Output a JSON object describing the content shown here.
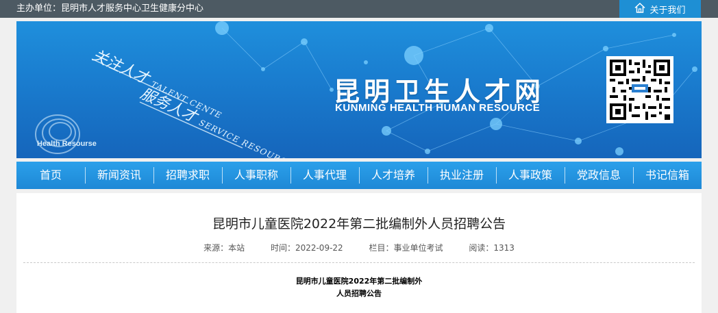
{
  "topbar": {
    "host": "主办单位：昆明市人才服务中心卫生健康分中心",
    "about_label": "关于我们",
    "about_icon": "home-icon"
  },
  "banner": {
    "site_title": "昆明卫生人才网",
    "site_subtitle": "KUNMING HEALTH HUMAN RESOURCE",
    "slogan1_cn": "关注人才",
    "slogan1_en": "TALENT CENTE",
    "slogan2_cn": "服务人才",
    "slogan2_en": "SERVICE RESOURCES",
    "logo_text": "Health Resourse",
    "bg_color": "#1a7ed0"
  },
  "nav": {
    "items": [
      {
        "label": "首页"
      },
      {
        "label": "新闻资讯"
      },
      {
        "label": "招聘求职"
      },
      {
        "label": "人事职称"
      },
      {
        "label": "人事代理"
      },
      {
        "label": "人才培养"
      },
      {
        "label": "执业注册"
      },
      {
        "label": "人事政策"
      },
      {
        "label": "党政信息"
      },
      {
        "label": "书记信箱"
      }
    ]
  },
  "article": {
    "title": "昆明市儿童医院2022年第二批编制外人员招聘公告",
    "source": "来源：本站",
    "time": "时间：2022-09-22",
    "column": "栏目：事业单位考试",
    "reads": "阅读：1313",
    "body_title_line1": "昆明市儿童医院2022年第二批编制外",
    "body_title_line2": "人员招聘公告"
  }
}
